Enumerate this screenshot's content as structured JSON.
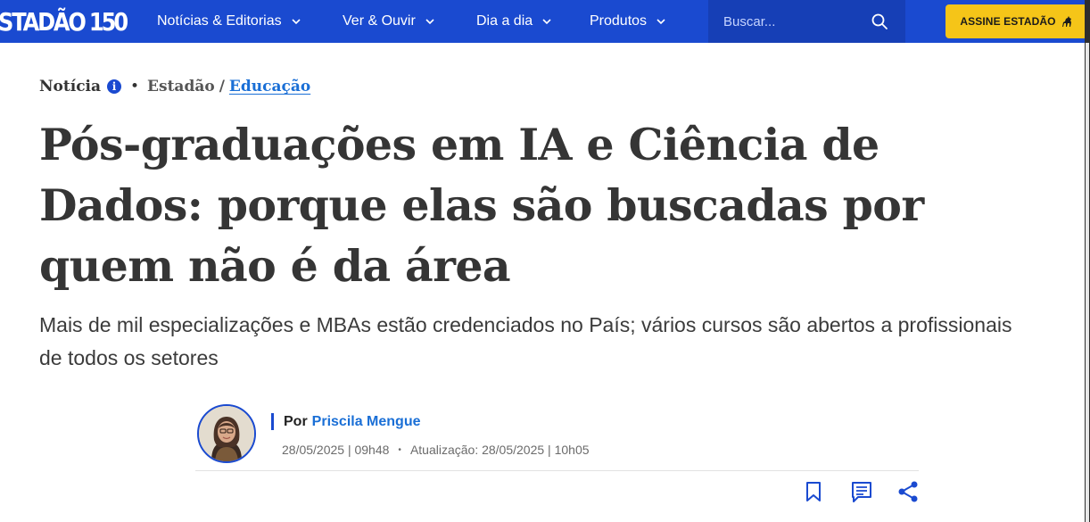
{
  "header": {
    "logo_text": "STADÃO",
    "logo_number": "150",
    "nav": [
      {
        "label": "Notícias & Editorias"
      },
      {
        "label": "Ver & Ouvir"
      },
      {
        "label": "Dia a dia"
      },
      {
        "label": "Produtos"
      }
    ],
    "search_placeholder": "Buscar...",
    "subscribe_label": "ASSINE ESTADÃO",
    "colors": {
      "nav_bg": "#1a4ad0",
      "search_bg": "#163fb6",
      "subscribe_bg": "#f5c518"
    }
  },
  "breadcrumb": {
    "kind": "Notícia",
    "info_symbol": "i",
    "separator": "•",
    "source": "Estadão",
    "slash": "/",
    "section": "Educação"
  },
  "article": {
    "title": "Pós-graduações em IA e Ciência de Dados: porque elas são buscadas por quem não é da área",
    "subtitle": "Mais de mil especializações e MBAs estão credenciados no País; vários cursos são abertos a profissionais de todos os setores"
  },
  "byline": {
    "by_label": "Por",
    "author": "Priscila Mengue",
    "published": "28/05/2025 | 09h48",
    "separator": "•",
    "updated": "Atualização: 28/05/2025 | 10h05"
  },
  "actions": [
    {
      "icon": "bookmark-icon"
    },
    {
      "icon": "comment-icon"
    },
    {
      "icon": "share-icon"
    }
  ]
}
